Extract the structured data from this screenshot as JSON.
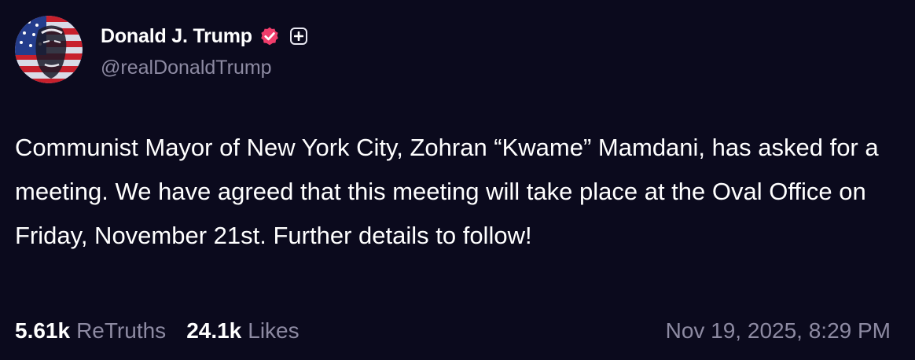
{
  "author": {
    "display_name": "Donald J. Trump",
    "handle": "@realDonaldTrump",
    "avatar_icon": "flag-portrait-avatar",
    "verified_icon": "verified-badge-icon",
    "verified_color": "#f03d6b",
    "plus_icon": "plus-badge-icon"
  },
  "post": {
    "text": "Communist Mayor of New York City, Zohran “Kwame” Mamdani, has asked for a meeting. We have agreed that this meeting will take place at the Oval Office on Friday, November 21st. Further details to follow!",
    "timestamp": "Nov 19, 2025, 8:29 PM"
  },
  "stats": {
    "retruths_count": "5.61k",
    "retruths_label": "ReTruths",
    "likes_count": "24.1k",
    "likes_label": "Likes"
  },
  "colors": {
    "background": "#0b0a1d",
    "text_primary": "#ffffff",
    "text_secondary": "#8d8aa2"
  }
}
